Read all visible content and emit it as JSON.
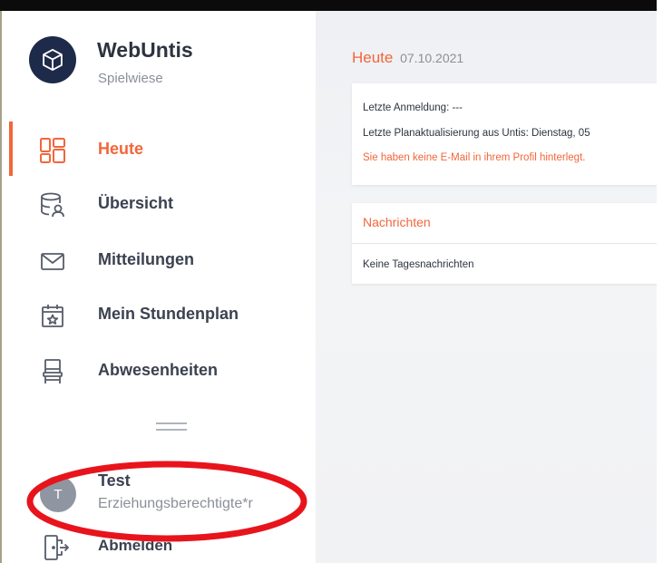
{
  "app": {
    "title": "WebUntis",
    "subtitle": "Spielwiese"
  },
  "sidebar": {
    "items": [
      {
        "label": "Heute",
        "icon": "dashboard-icon",
        "active": true
      },
      {
        "label": "Übersicht",
        "icon": "overview-database-icon",
        "active": false
      },
      {
        "label": "Mitteilungen",
        "icon": "envelope-icon",
        "active": false
      },
      {
        "label": "Mein Stundenplan",
        "icon": "calendar-star-icon",
        "active": false
      },
      {
        "label": "Abwesenheiten",
        "icon": "chair-icon",
        "active": false
      }
    ]
  },
  "user": {
    "initial": "T",
    "name": "Test",
    "role": "Erziehungsberechtigte*r",
    "logout_label": "Abmelden"
  },
  "main": {
    "title": "Heute",
    "date": "07.10.2021",
    "info": {
      "last_login": "Letzte Anmeldung: ---",
      "last_update": "Letzte Planaktualisierung aus Untis: Dienstag, 05",
      "warning": "Sie haben keine E-Mail in ihrem Profil hinterlegt."
    },
    "news": {
      "header": "Nachrichten",
      "empty": "Keine Tagesnachrichten"
    }
  },
  "colors": {
    "accent": "#f2663a",
    "logo_bg": "#1e2a4a",
    "text": "#3b4150",
    "muted": "#8a8f99",
    "highlight": "#e8141c"
  }
}
